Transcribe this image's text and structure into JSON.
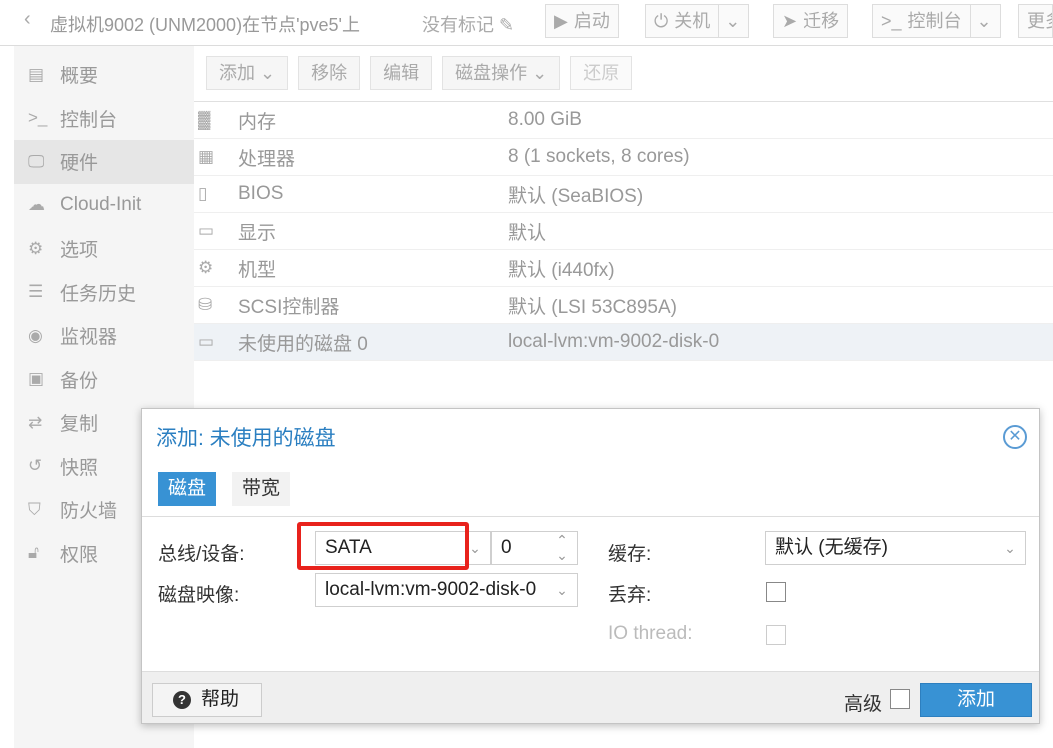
{
  "header": {
    "title": "虚拟机9002 (UNM2000)在节点'pve5'上",
    "tags": "没有标记",
    "buttons": {
      "start": "启动",
      "shutdown": "关机",
      "migrate": "迁移",
      "console": "控制台",
      "more": "更多"
    }
  },
  "sidebar": {
    "items": [
      {
        "label": "概要",
        "icon": "book-icon"
      },
      {
        "label": "控制台",
        "icon": "terminal-icon"
      },
      {
        "label": "硬件",
        "icon": "monitor-icon"
      },
      {
        "label": "Cloud-Init",
        "icon": "cloud-icon"
      },
      {
        "label": "选项",
        "icon": "gear-icon"
      },
      {
        "label": "任务历史",
        "icon": "list-icon"
      },
      {
        "label": "监视器",
        "icon": "eye-icon"
      },
      {
        "label": "备份",
        "icon": "floppy-icon"
      },
      {
        "label": "复制",
        "icon": "retweet-icon"
      },
      {
        "label": "快照",
        "icon": "history-icon"
      },
      {
        "label": "防火墙",
        "icon": "shield-icon"
      },
      {
        "label": "权限",
        "icon": "unlock-icon"
      }
    ]
  },
  "toolbar": {
    "add": "添加",
    "remove": "移除",
    "edit": "编辑",
    "disk_action": "磁盘操作",
    "revert": "还原"
  },
  "hardware": [
    {
      "name": "内存",
      "value": "8.00 GiB",
      "icon": "memory-icon"
    },
    {
      "name": "处理器",
      "value": "8 (1 sockets, 8 cores)",
      "icon": "cpu-icon"
    },
    {
      "name": "BIOS",
      "value": "默认 (SeaBIOS)",
      "icon": "chip-icon"
    },
    {
      "name": "显示",
      "value": "默认",
      "icon": "desktop-icon"
    },
    {
      "name": "机型",
      "value": "默认 (i440fx)",
      "icon": "cogs-icon"
    },
    {
      "name": "SCSI控制器",
      "value": "默认 (LSI 53C895A)",
      "icon": "database-icon"
    },
    {
      "name": "未使用的磁盘 0",
      "value": "local-lvm:vm-9002-disk-0",
      "icon": "hdd-icon"
    }
  ],
  "dialog": {
    "title": "添加: 未使用的磁盘",
    "tabs": [
      "磁盘",
      "带宽"
    ],
    "bus_label": "总线/设备:",
    "bus_value": "SATA",
    "device_number": "0",
    "image_label": "磁盘映像:",
    "image_value": "local-lvm:vm-9002-disk-0",
    "cache_label": "缓存:",
    "cache_value": "默认 (无缓存)",
    "discard_label": "丢弃:",
    "iothread_label": "IO thread:",
    "help": "帮助",
    "advanced": "高级",
    "add": "添加"
  },
  "colors": {
    "accent": "#3892d4",
    "highlight": "#e8221c"
  }
}
